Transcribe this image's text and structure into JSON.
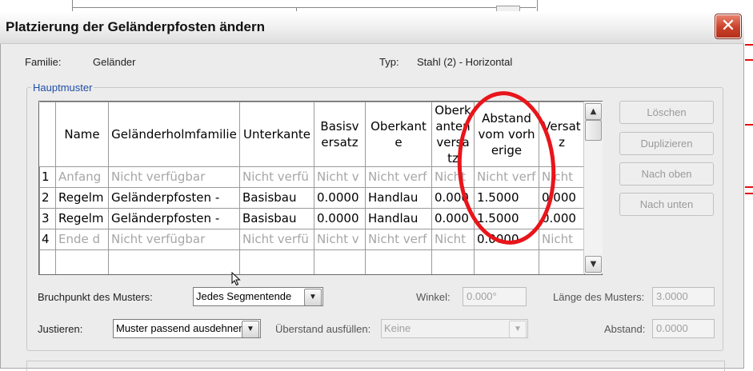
{
  "dialog": {
    "title": "Platzierung der Geländerpfosten ändern",
    "close_glyph": "✕"
  },
  "info": {
    "family_label": "Familie:",
    "family_value": "Geländer",
    "type_label": "Typ:",
    "type_value": "Stahl (2) - Horizontal"
  },
  "main_pattern": {
    "legend": "Hauptmuster",
    "columns": [
      "Name",
      "Geländerholmfamilie",
      "Unterkante",
      "Basisversatz",
      "Oberkante",
      "Oberkanten versatz",
      "Abstand vom vorherige",
      "Versatz"
    ],
    "rows": [
      {
        "num": "1",
        "cells": [
          "Anfang",
          "Nicht verfügbar",
          "Nicht verfü",
          "Nicht v",
          "Nicht verf",
          "Nicht",
          "Nicht verf",
          "Nicht"
        ],
        "disabled": true
      },
      {
        "num": "2",
        "cells": [
          "Regelm",
          "Geländerpfosten -",
          "Basisbau",
          "0.0000",
          "Handlau",
          "0.000",
          "1.5000",
          "0.000"
        ],
        "disabled": false
      },
      {
        "num": "3",
        "cells": [
          "Regelm",
          "Geländerpfosten -",
          "Basisbau",
          "0.0000",
          "Handlau",
          "0.000",
          "1.5000",
          "0.000"
        ],
        "disabled": false
      },
      {
        "num": "4",
        "cells": [
          "Ende d",
          "Nicht verfügbar",
          "Nicht verfü",
          "Nicht v",
          "Nicht verf",
          "Nicht",
          "0.0000",
          "Nicht"
        ],
        "disabled": true
      }
    ]
  },
  "buttons": {
    "delete": "Löschen",
    "duplicate": "Duplizieren",
    "move_up": "Nach oben",
    "move_down": "Nach unten"
  },
  "settings": {
    "break_label": "Bruchpunkt des Musters:",
    "break_value": "Jedes Segmentende",
    "angle_label": "Winkel:",
    "angle_value": "0.000°",
    "pattern_length_label": "Länge des Musters:",
    "pattern_length_value": "3.0000",
    "justify_label": "Justieren:",
    "justify_value": "Muster passend ausdehnen",
    "fill_label": "Überstand ausfüllen:",
    "fill_value": "Keine",
    "spacing_label": "Abstand:",
    "spacing_value": "0.0000"
  },
  "icons": {
    "dropdown_arrow": "▼",
    "scroll_up": "▲",
    "scroll_down": "▼"
  },
  "colors": {
    "highlight_circle": "#e8151b",
    "close_button": "#c8412a",
    "legend_text": "#1f4ea8"
  }
}
